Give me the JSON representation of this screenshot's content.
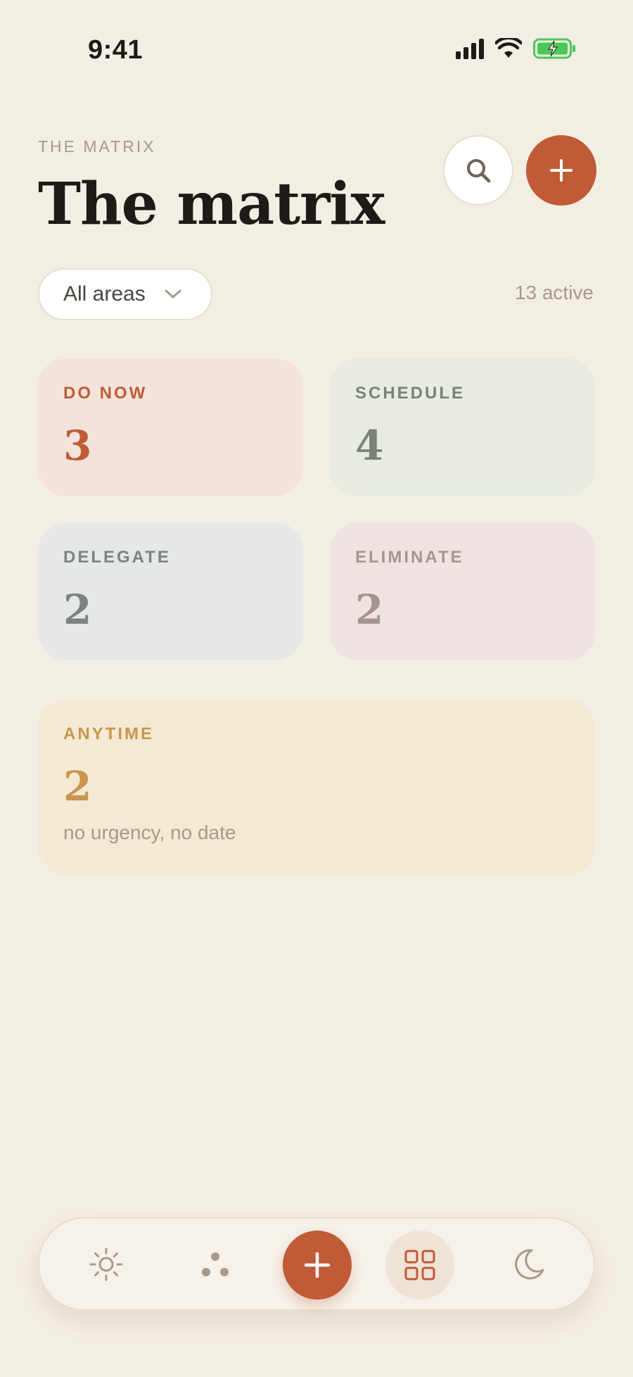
{
  "status_bar": {
    "time": "9:41",
    "icons": [
      "cellular-signal-icon",
      "wifi-icon",
      "battery-charging-icon"
    ],
    "battery_color": "#4cc75a"
  },
  "header": {
    "eyebrow": "THE MATRIX",
    "title": "The matrix",
    "search_icon": "search-icon",
    "add_icon": "plus-icon"
  },
  "filter": {
    "area_label": "All areas",
    "active_count": "13 active"
  },
  "quadrants": {
    "do_now": {
      "label": "DO NOW",
      "count": "3",
      "color": "#c05a37"
    },
    "schedule": {
      "label": "SCHEDULE",
      "count": "4",
      "color": "#7c8177"
    },
    "delegate": {
      "label": "DELEGATE",
      "count": "2",
      "color": "#7d8480"
    },
    "eliminate": {
      "label": "ELIMINATE",
      "count": "2",
      "color": "#a8948f"
    },
    "anytime": {
      "label": "ANYTIME",
      "count": "2",
      "note": "no urgency, no date",
      "color": "#c9954f"
    }
  },
  "bottom_nav": {
    "items": [
      "sun-icon",
      "dots-icon",
      "plus-icon",
      "grid-icon",
      "moon-icon"
    ],
    "accent": "#c05a37"
  }
}
